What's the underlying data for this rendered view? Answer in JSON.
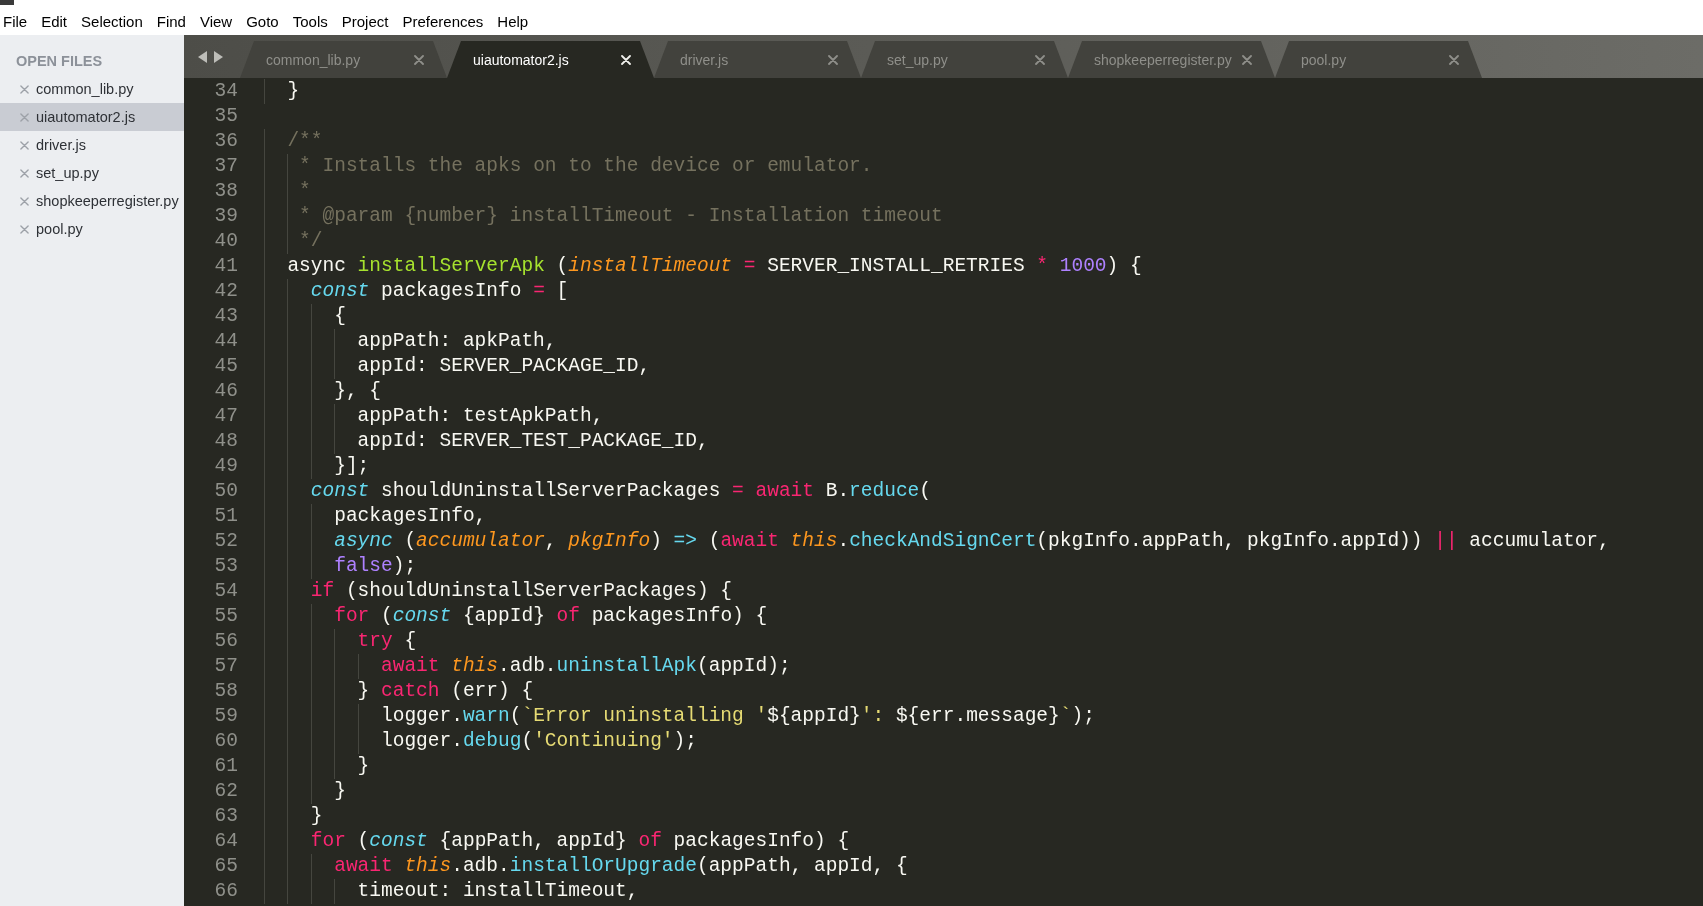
{
  "menu_bar": {
    "items": [
      "File",
      "Edit",
      "Selection",
      "Find",
      "View",
      "Goto",
      "Tools",
      "Project",
      "Preferences",
      "Help"
    ]
  },
  "sidebar": {
    "heading": "OPEN FILES",
    "items": [
      {
        "label": "common_lib.py",
        "selected": false
      },
      {
        "label": "uiautomator2.js",
        "selected": true
      },
      {
        "label": "driver.js",
        "selected": false
      },
      {
        "label": "set_up.py",
        "selected": false
      },
      {
        "label": "shopkeeperregister.py",
        "selected": false
      },
      {
        "label": "pool.py",
        "selected": false
      }
    ]
  },
  "tabs": [
    {
      "label": "common_lib.py",
      "selected": false
    },
    {
      "label": "uiautomator2.js",
      "selected": true
    },
    {
      "label": "driver.js",
      "selected": false
    },
    {
      "label": "set_up.py",
      "selected": false
    },
    {
      "label": "shopkeeperregister.py",
      "selected": false
    },
    {
      "label": "pool.py",
      "selected": false
    }
  ],
  "editor": {
    "lines": [
      {
        "number": "34",
        "tokens": [
          {
            "kind": "plain",
            "text": "  }"
          }
        ]
      },
      {
        "number": "35"
      },
      {
        "number": "36",
        "tokens": [
          {
            "kind": "comment",
            "text": "  /**"
          }
        ]
      },
      {
        "number": "37",
        "tokens": [
          {
            "kind": "comment",
            "text": "   * Installs the apks on to the device or emulator."
          }
        ]
      },
      {
        "number": "38",
        "tokens": [
          {
            "kind": "comment",
            "text": "   *"
          }
        ]
      },
      {
        "number": "39",
        "tokens": [
          {
            "kind": "comment",
            "text": "   * @param {number} installTimeout - Installation timeout"
          }
        ]
      },
      {
        "number": "40",
        "tokens": [
          {
            "kind": "comment",
            "text": "   */"
          }
        ]
      },
      {
        "number": "41",
        "tokens": [
          {
            "kind": "plain",
            "text": "  async "
          },
          {
            "kind": "entity",
            "text": "installServerApk"
          },
          {
            "kind": "plain",
            "text": " ("
          },
          {
            "kind": "parameter",
            "text": "installTimeout"
          },
          {
            "kind": "keyword",
            "text": " ="
          },
          {
            "kind": "plain",
            "text": " SERVER_INSTALL_RETRIES "
          },
          {
            "kind": "keyword",
            "text": "*"
          },
          {
            "kind": "number",
            "text": " 1000"
          },
          {
            "kind": "plain",
            "text": ") {"
          }
        ]
      },
      {
        "number": "42",
        "tokens": [
          {
            "kind": "storage",
            "text": "    const"
          },
          {
            "kind": "plain",
            "text": " packagesInfo "
          },
          {
            "kind": "keyword",
            "text": "="
          },
          {
            "kind": "plain",
            "text": " ["
          }
        ]
      },
      {
        "number": "43",
        "tokens": [
          {
            "kind": "plain",
            "text": "      {"
          }
        ]
      },
      {
        "number": "44",
        "tokens": [
          {
            "kind": "plain",
            "text": "        appPath: apkPath,"
          }
        ]
      },
      {
        "number": "45",
        "tokens": [
          {
            "kind": "plain",
            "text": "        appId: SERVER_PACKAGE_ID,"
          }
        ]
      },
      {
        "number": "46",
        "tokens": [
          {
            "kind": "plain",
            "text": "      }, {"
          }
        ]
      },
      {
        "number": "47",
        "tokens": [
          {
            "kind": "plain",
            "text": "        appPath: testApkPath,"
          }
        ]
      },
      {
        "number": "48",
        "tokens": [
          {
            "kind": "plain",
            "text": "        appId: SERVER_TEST_PACKAGE_ID,"
          }
        ]
      },
      {
        "number": "49",
        "tokens": [
          {
            "kind": "plain",
            "text": "      }];"
          }
        ]
      },
      {
        "number": "50",
        "tokens": [
          {
            "kind": "storage",
            "text": "    const"
          },
          {
            "kind": "plain",
            "text": " shouldUninstallServerPackages "
          },
          {
            "kind": "keyword",
            "text": "= await"
          },
          {
            "kind": "plain",
            "text": " B."
          },
          {
            "kind": "support",
            "text": "reduce"
          },
          {
            "kind": "plain",
            "text": "("
          }
        ]
      },
      {
        "number": "51",
        "tokens": [
          {
            "kind": "plain",
            "text": "      packagesInfo,"
          }
        ]
      },
      {
        "number": "52",
        "tokens": [
          {
            "kind": "storage",
            "text": "      async"
          },
          {
            "kind": "plain",
            "text": " ("
          },
          {
            "kind": "parameter",
            "text": "accumulator"
          },
          {
            "kind": "plain",
            "text": ", "
          },
          {
            "kind": "parameter",
            "text": "pkgInfo"
          },
          {
            "kind": "plain",
            "text": ") "
          },
          {
            "kind": "support",
            "text": "=>"
          },
          {
            "kind": "plain",
            "text": " ("
          },
          {
            "kind": "keyword",
            "text": "await"
          },
          {
            "kind": "language",
            "text": " this"
          },
          {
            "kind": "plain",
            "text": "."
          },
          {
            "kind": "support",
            "text": "checkAndSignCert"
          },
          {
            "kind": "plain",
            "text": "(pkgInfo.appPath, pkgInfo.appId)) "
          },
          {
            "kind": "keyword",
            "text": "||"
          },
          {
            "kind": "plain",
            "text": " accumulator,"
          }
        ]
      },
      {
        "number": "53",
        "tokens": [
          {
            "kind": "number",
            "text": "      false"
          },
          {
            "kind": "plain",
            "text": ");"
          }
        ]
      },
      {
        "number": "54",
        "tokens": [
          {
            "kind": "keyword",
            "text": "    if"
          },
          {
            "kind": "plain",
            "text": " (shouldUninstallServerPackages) {"
          }
        ]
      },
      {
        "number": "55",
        "tokens": [
          {
            "kind": "keyword",
            "text": "      for"
          },
          {
            "kind": "plain",
            "text": " ("
          },
          {
            "kind": "storage",
            "text": "const"
          },
          {
            "kind": "plain",
            "text": " {appId} "
          },
          {
            "kind": "keyword",
            "text": "of"
          },
          {
            "kind": "plain",
            "text": " packagesInfo) {"
          }
        ]
      },
      {
        "number": "56",
        "tokens": [
          {
            "kind": "keyword",
            "text": "        try"
          },
          {
            "kind": "plain",
            "text": " {"
          }
        ]
      },
      {
        "number": "57",
        "tokens": [
          {
            "kind": "keyword",
            "text": "          await"
          },
          {
            "kind": "language",
            "text": " this"
          },
          {
            "kind": "plain",
            "text": ".adb."
          },
          {
            "kind": "support",
            "text": "uninstallApk"
          },
          {
            "kind": "plain",
            "text": "(appId);"
          }
        ]
      },
      {
        "number": "58",
        "tokens": [
          {
            "kind": "plain",
            "text": "        } "
          },
          {
            "kind": "keyword",
            "text": "catch"
          },
          {
            "kind": "plain",
            "text": " (err) {"
          }
        ]
      },
      {
        "number": "59",
        "tokens": [
          {
            "kind": "plain",
            "text": "          logger."
          },
          {
            "kind": "support",
            "text": "warn"
          },
          {
            "kind": "plain",
            "text": "("
          },
          {
            "kind": "string",
            "text": "`Error uninstalling '"
          },
          {
            "kind": "plain",
            "text": "${appId}"
          },
          {
            "kind": "string",
            "text": "': "
          },
          {
            "kind": "plain",
            "text": "${err.message}"
          },
          {
            "kind": "string",
            "text": "`"
          },
          {
            "kind": "plain",
            "text": ");"
          }
        ]
      },
      {
        "number": "60",
        "tokens": [
          {
            "kind": "plain",
            "text": "          logger."
          },
          {
            "kind": "support",
            "text": "debug"
          },
          {
            "kind": "plain",
            "text": "("
          },
          {
            "kind": "string",
            "text": "'Continuing'"
          },
          {
            "kind": "plain",
            "text": ");"
          }
        ]
      },
      {
        "number": "61",
        "tokens": [
          {
            "kind": "plain",
            "text": "        }"
          }
        ]
      },
      {
        "number": "62",
        "tokens": [
          {
            "kind": "plain",
            "text": "      }"
          }
        ]
      },
      {
        "number": "63",
        "tokens": [
          {
            "kind": "plain",
            "text": "    }"
          }
        ]
      },
      {
        "number": "64",
        "tokens": [
          {
            "kind": "keyword",
            "text": "    for"
          },
          {
            "kind": "plain",
            "text": " ("
          },
          {
            "kind": "storage",
            "text": "const"
          },
          {
            "kind": "plain",
            "text": " {appPath, appId} "
          },
          {
            "kind": "keyword",
            "text": "of"
          },
          {
            "kind": "plain",
            "text": " packagesInfo) {"
          }
        ]
      },
      {
        "number": "65",
        "tokens": [
          {
            "kind": "keyword",
            "text": "      await"
          },
          {
            "kind": "language",
            "text": " this"
          },
          {
            "kind": "plain",
            "text": ".adb."
          },
          {
            "kind": "support",
            "text": "installOrUpgrade"
          },
          {
            "kind": "plain",
            "text": "(appPath, appId, {"
          }
        ]
      },
      {
        "number": "66",
        "tokens": [
          {
            "kind": "plain",
            "text": "        timeout: installTimeout,"
          }
        ]
      }
    ]
  }
}
